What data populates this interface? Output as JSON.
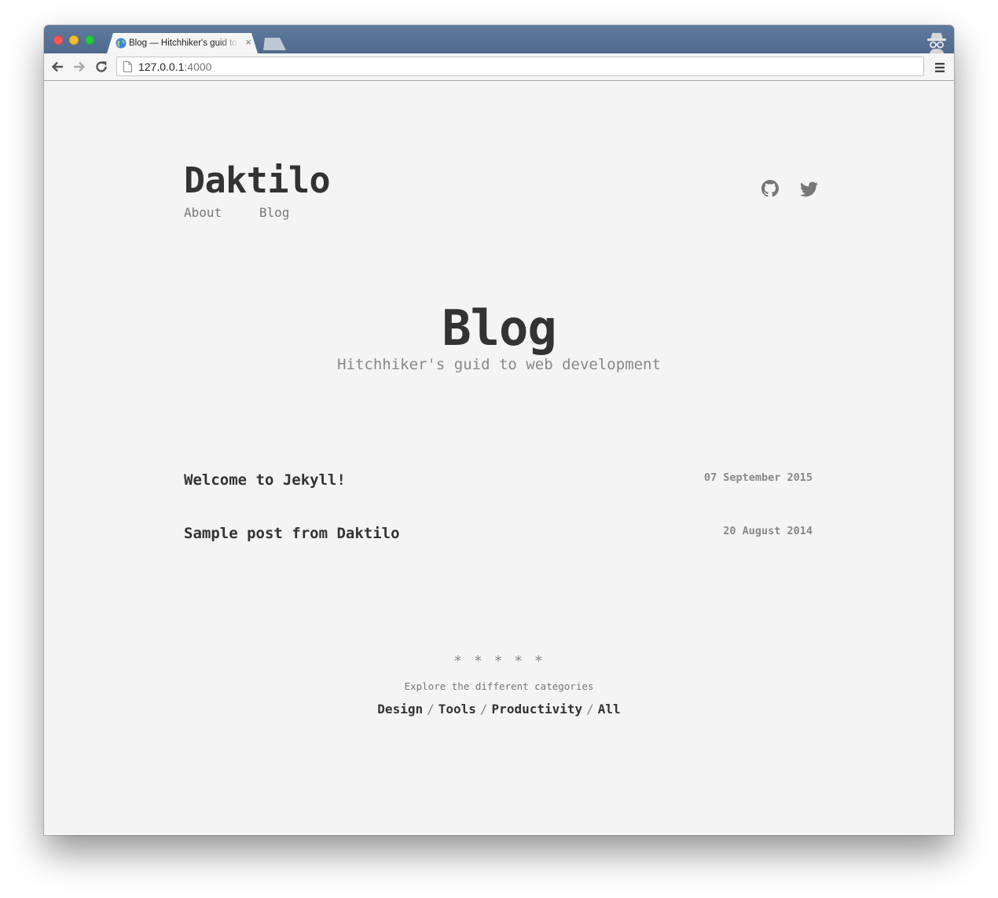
{
  "browser": {
    "tab_title": "Blog — Hitchhiker's guid to web development",
    "tab_close": "×",
    "url_host": "127.0.0.1",
    "url_port": ":4000"
  },
  "site": {
    "title": "Daktilo",
    "nav": [
      "About",
      "Blog"
    ],
    "social_icons": [
      "github-icon",
      "twitter-icon"
    ]
  },
  "hero": {
    "title": "Blog",
    "subtitle": "Hitchhiker's guid to web development"
  },
  "posts": [
    {
      "title": "Welcome to Jekyll!",
      "date": "07 September 2015"
    },
    {
      "title": "Sample post from Daktilo",
      "date": "20 August 2014"
    }
  ],
  "footer": {
    "divider": "* * * * *",
    "explore_text": "Explore the different categories",
    "categories": [
      "Design",
      "Tools",
      "Productivity",
      "All"
    ],
    "separator": "/"
  },
  "colors": {
    "page_background": "#f4f4f4",
    "text_dark": "#333333",
    "text_muted": "#888888",
    "tabstrip": "#5a7597"
  }
}
